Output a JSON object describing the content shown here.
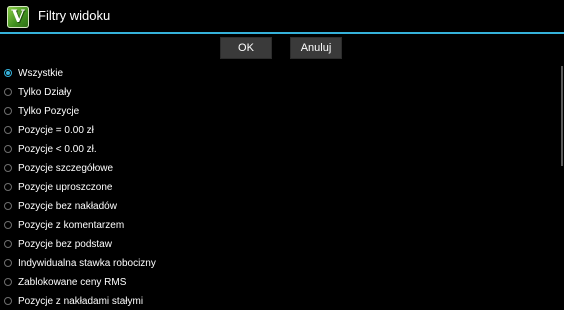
{
  "titlebar": {
    "title": "Filtry widoku",
    "icon_letter": "V"
  },
  "buttons": {
    "ok_label": "OK",
    "cancel_label": "Anuluj"
  },
  "colors": {
    "accent": "#35b1da",
    "background": "#000000"
  },
  "options": [
    {
      "label": "Wszystkie",
      "checked": true
    },
    {
      "label": "Tylko Działy",
      "checked": false
    },
    {
      "label": "Tylko Pozycje",
      "checked": false
    },
    {
      "label": "Pozycje = 0.00 zł",
      "checked": false
    },
    {
      "label": "Pozycje < 0.00 zł.",
      "checked": false
    },
    {
      "label": "Pozycje szczegółowe",
      "checked": false
    },
    {
      "label": "Pozycje uproszczone",
      "checked": false
    },
    {
      "label": "Pozycje bez nakładów",
      "checked": false
    },
    {
      "label": "Pozycje z komentarzem",
      "checked": false
    },
    {
      "label": "Pozycje bez podstaw",
      "checked": false
    },
    {
      "label": "Indywidualna stawka robocizny",
      "checked": false
    },
    {
      "label": "Zablokowane ceny RMS",
      "checked": false
    },
    {
      "label": "Pozycje z nakładami stałymi",
      "checked": false
    }
  ]
}
